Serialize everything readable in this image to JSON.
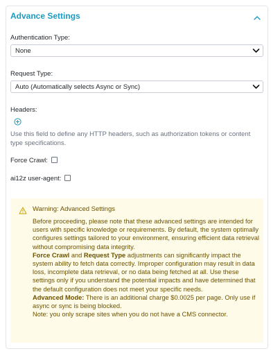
{
  "panel": {
    "title": "Advance Settings"
  },
  "authentication": {
    "label": "Authentication Type:",
    "value": "None"
  },
  "request": {
    "label": "Request Type:",
    "value": "Auto (Automatically selects Async or Sync)"
  },
  "headers": {
    "label": "Headers:",
    "help": "Use this field to define any HTTP headers, such as authorization tokens or content type specifications."
  },
  "force_crawl": {
    "label": "Force Crawl:",
    "checked": false
  },
  "user_agent": {
    "label": "ai12z user-agent:",
    "checked": false
  },
  "warning": {
    "title": "Warning: Advanced Settings",
    "intro": "Before proceeding, please note that these advanced settings are intended for users with specific knowledge or requirements. By default, the system optimally configures settings tailored to your environment, ensuring efficient data retrieval without compromising data integrity.",
    "force_crawl_term": "Force Crawl",
    "and_word": "and",
    "request_type_term": "Request Type",
    "adjustments_text": "adjustments can significantly impact the system ability to fetch data correctly. Improper configuration may result in data loss, incomplete data retrieval, or no data being fetched at all. Use these settings only if you understand the potential impacts and have determined that the default configuration does not meet your specific needs.",
    "advanced_mode_term": "Advanced Mode:",
    "advanced_mode_text": "There is an additional charge $0.0025 per page. Only use if async or sync is being blocked.",
    "note": "Note: you only scrape sites when you do not have a CMS connector."
  },
  "colors": {
    "accent": "#1a9bbf",
    "warning_bg": "#fffbe9",
    "warning_text": "#6b5200"
  },
  "icons": {
    "collapse": "chevron-up-icon",
    "select_arrow": "chevron-down-icon",
    "add": "plus-circle-icon",
    "warning": "warning-triangle-icon"
  }
}
